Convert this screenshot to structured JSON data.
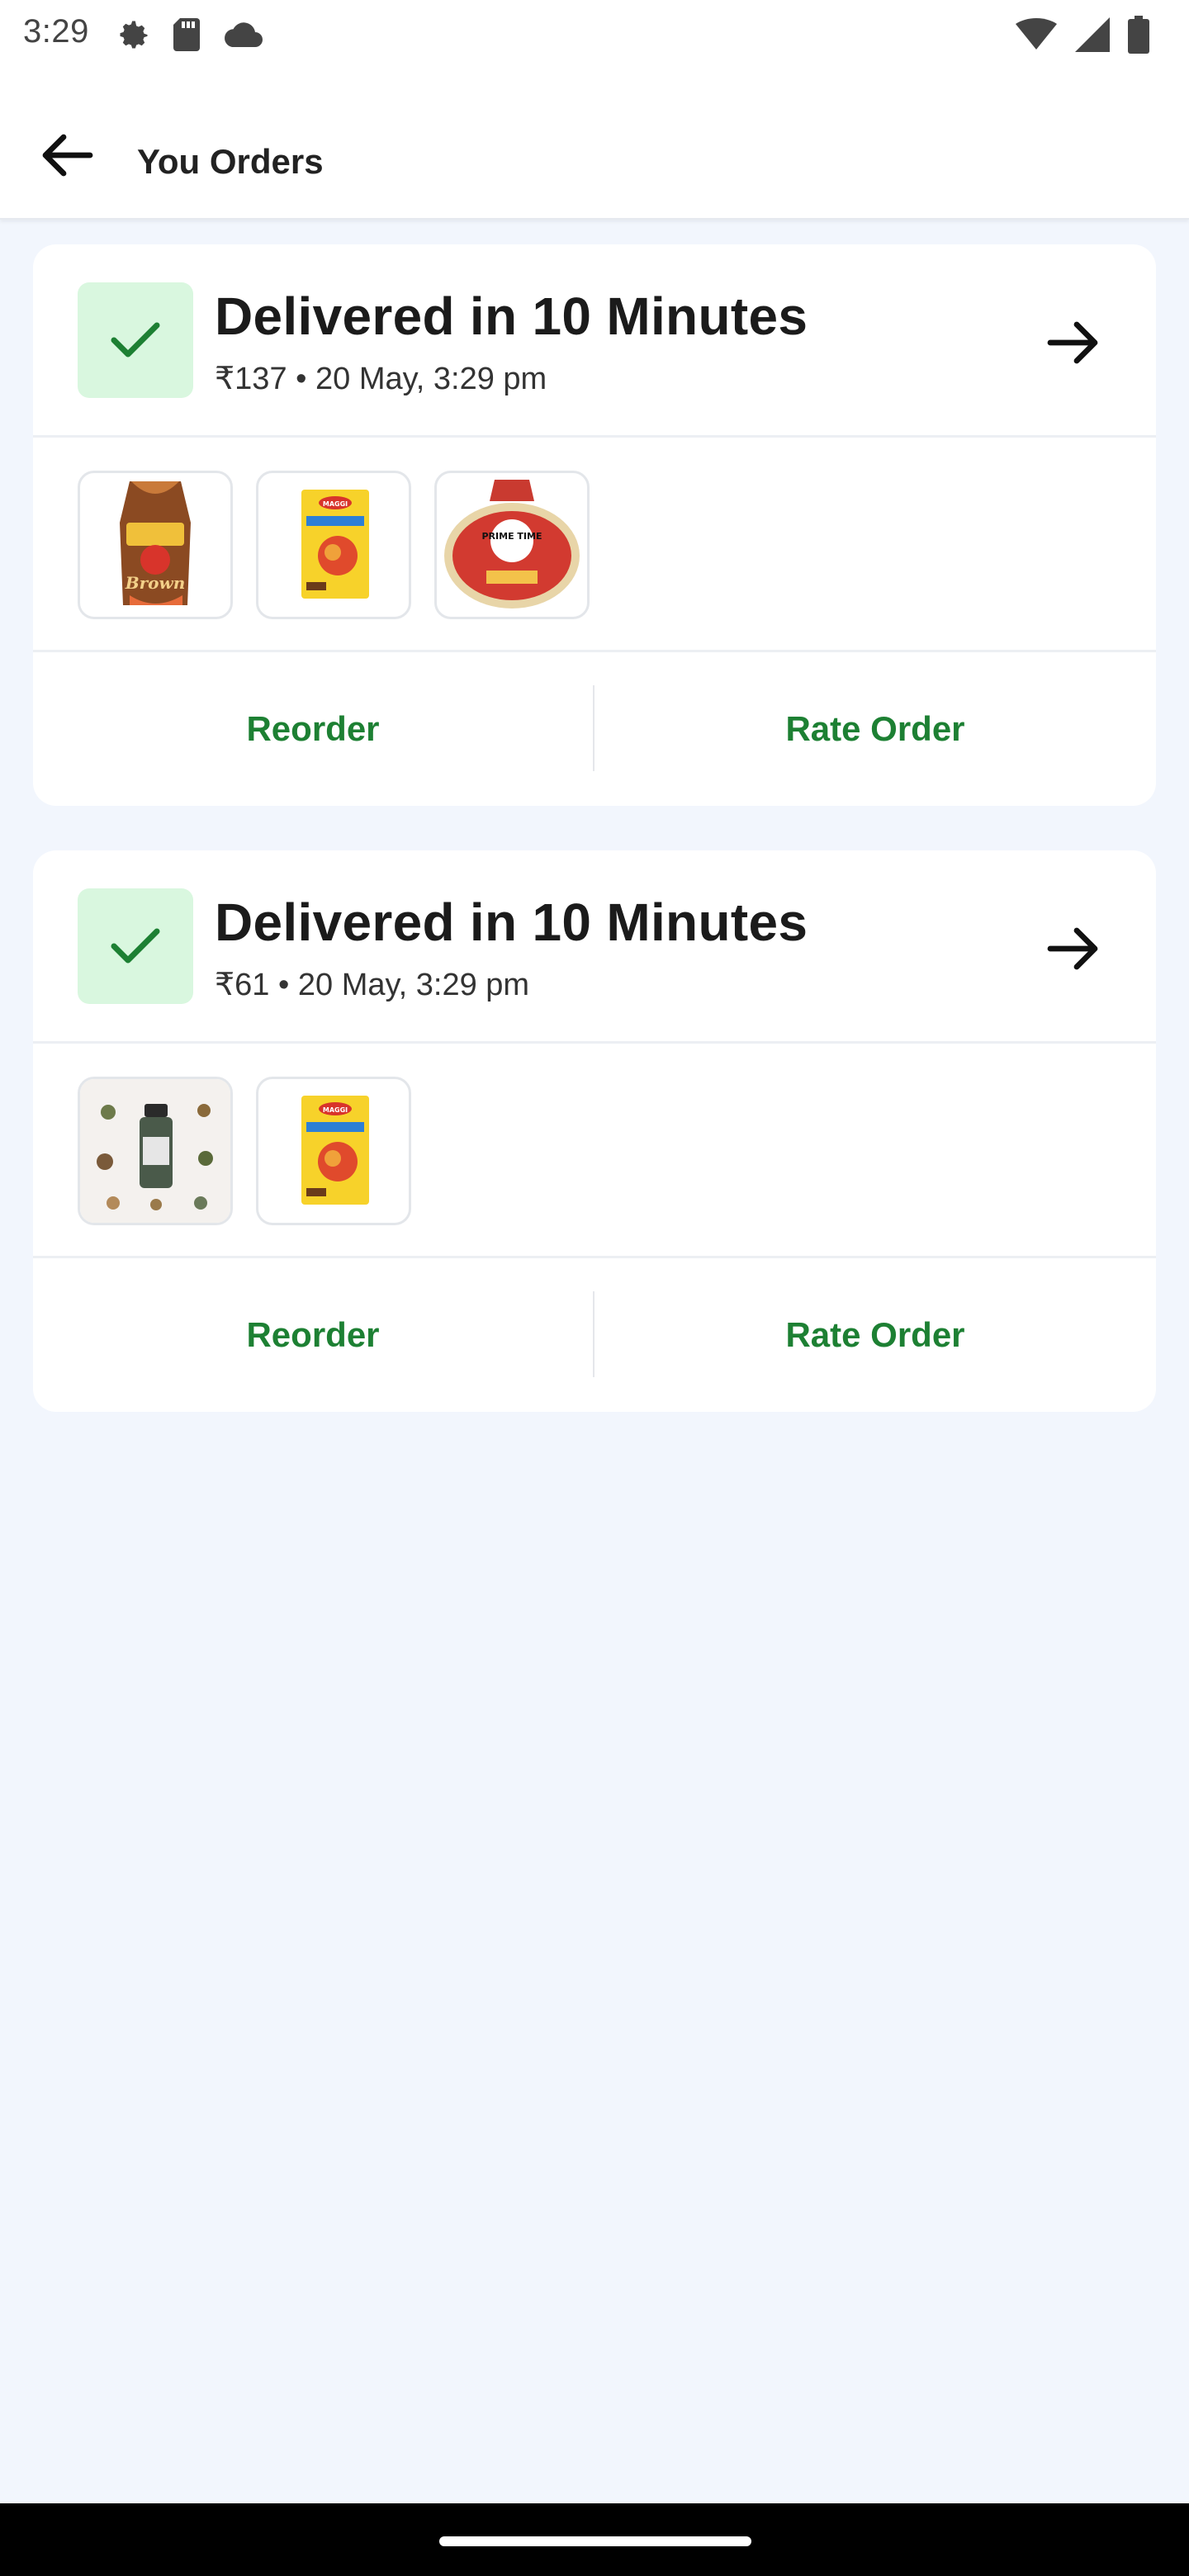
{
  "status_bar": {
    "time": "3:29",
    "left_icons": [
      "gear-icon",
      "sd-card-icon",
      "cloud-icon"
    ],
    "right_icons": [
      "wifi-icon",
      "signal-icon",
      "battery-icon"
    ]
  },
  "header": {
    "title": "You Orders",
    "back_icon": "arrow-left-icon"
  },
  "colors": {
    "accent_green": "#1d8033",
    "check_tile": "#d9f7df",
    "background": "#f2f6fd"
  },
  "orders": [
    {
      "status": "Delivered in 10 Minutes",
      "meta": "₹137 • 20 May, 3:29 pm",
      "products": [
        {
          "name": "Britannia Brown Bread",
          "icon": "bread-pack-image",
          "logo_text": "Brown"
        },
        {
          "name": "Maggi Noodles",
          "icon": "maggi-pack-image",
          "logo_text": "MAGGI"
        },
        {
          "name": "Prime Time Kulcha",
          "icon": "kulcha-pack-image",
          "logo_text": "PRIME TIME"
        }
      ],
      "reorder_label": "Reorder",
      "rate_label": "Rate Order"
    },
    {
      "status": "Delivered in 10 Minutes",
      "meta": "₹61 • 20 May, 3:29 pm",
      "products": [
        {
          "name": "Seasoning Jar",
          "icon": "seasoning-jar-image",
          "logo_text": ""
        },
        {
          "name": "Maggi Noodles",
          "icon": "maggi-pack-image",
          "logo_text": "MAGGI"
        }
      ],
      "reorder_label": "Reorder",
      "rate_label": "Rate Order"
    }
  ]
}
